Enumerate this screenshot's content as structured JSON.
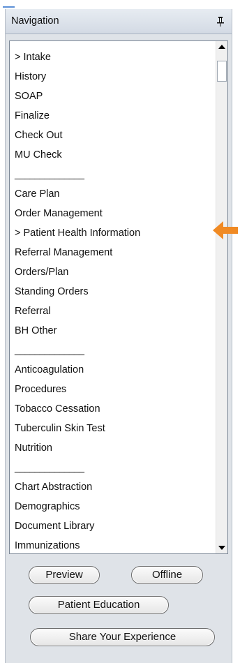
{
  "header": {
    "title": "Navigation"
  },
  "icons": {
    "pin": "pin-icon",
    "scroll_up": "scroll-up-icon",
    "scroll_down": "scroll-down-icon",
    "pointer": "arrow-left-icon"
  },
  "colors": {
    "accent_arrow": "#f08a24",
    "panel": "#dfe3e8"
  },
  "nav_items": [
    "> Intake",
    "History",
    "SOAP",
    "Finalize",
    "Check Out",
    "MU Check",
    "______________",
    "Care Plan",
    "Order Management",
    "> Patient Health Information",
    "Referral Management",
    "Orders/Plan",
    "Standing Orders",
    "Referral",
    "BH Other",
    "______________",
    "Anticoagulation",
    "Procedures",
    "Tobacco Cessation",
    "Tuberculin Skin Test",
    "Nutrition",
    "______________",
    "Chart Abstraction",
    "Demographics",
    "Document Library",
    "Immunizations"
  ],
  "buttons": {
    "preview": "Preview",
    "offline": "Offline",
    "patient_education": "Patient Education",
    "share_experience": "Share Your Experience"
  }
}
